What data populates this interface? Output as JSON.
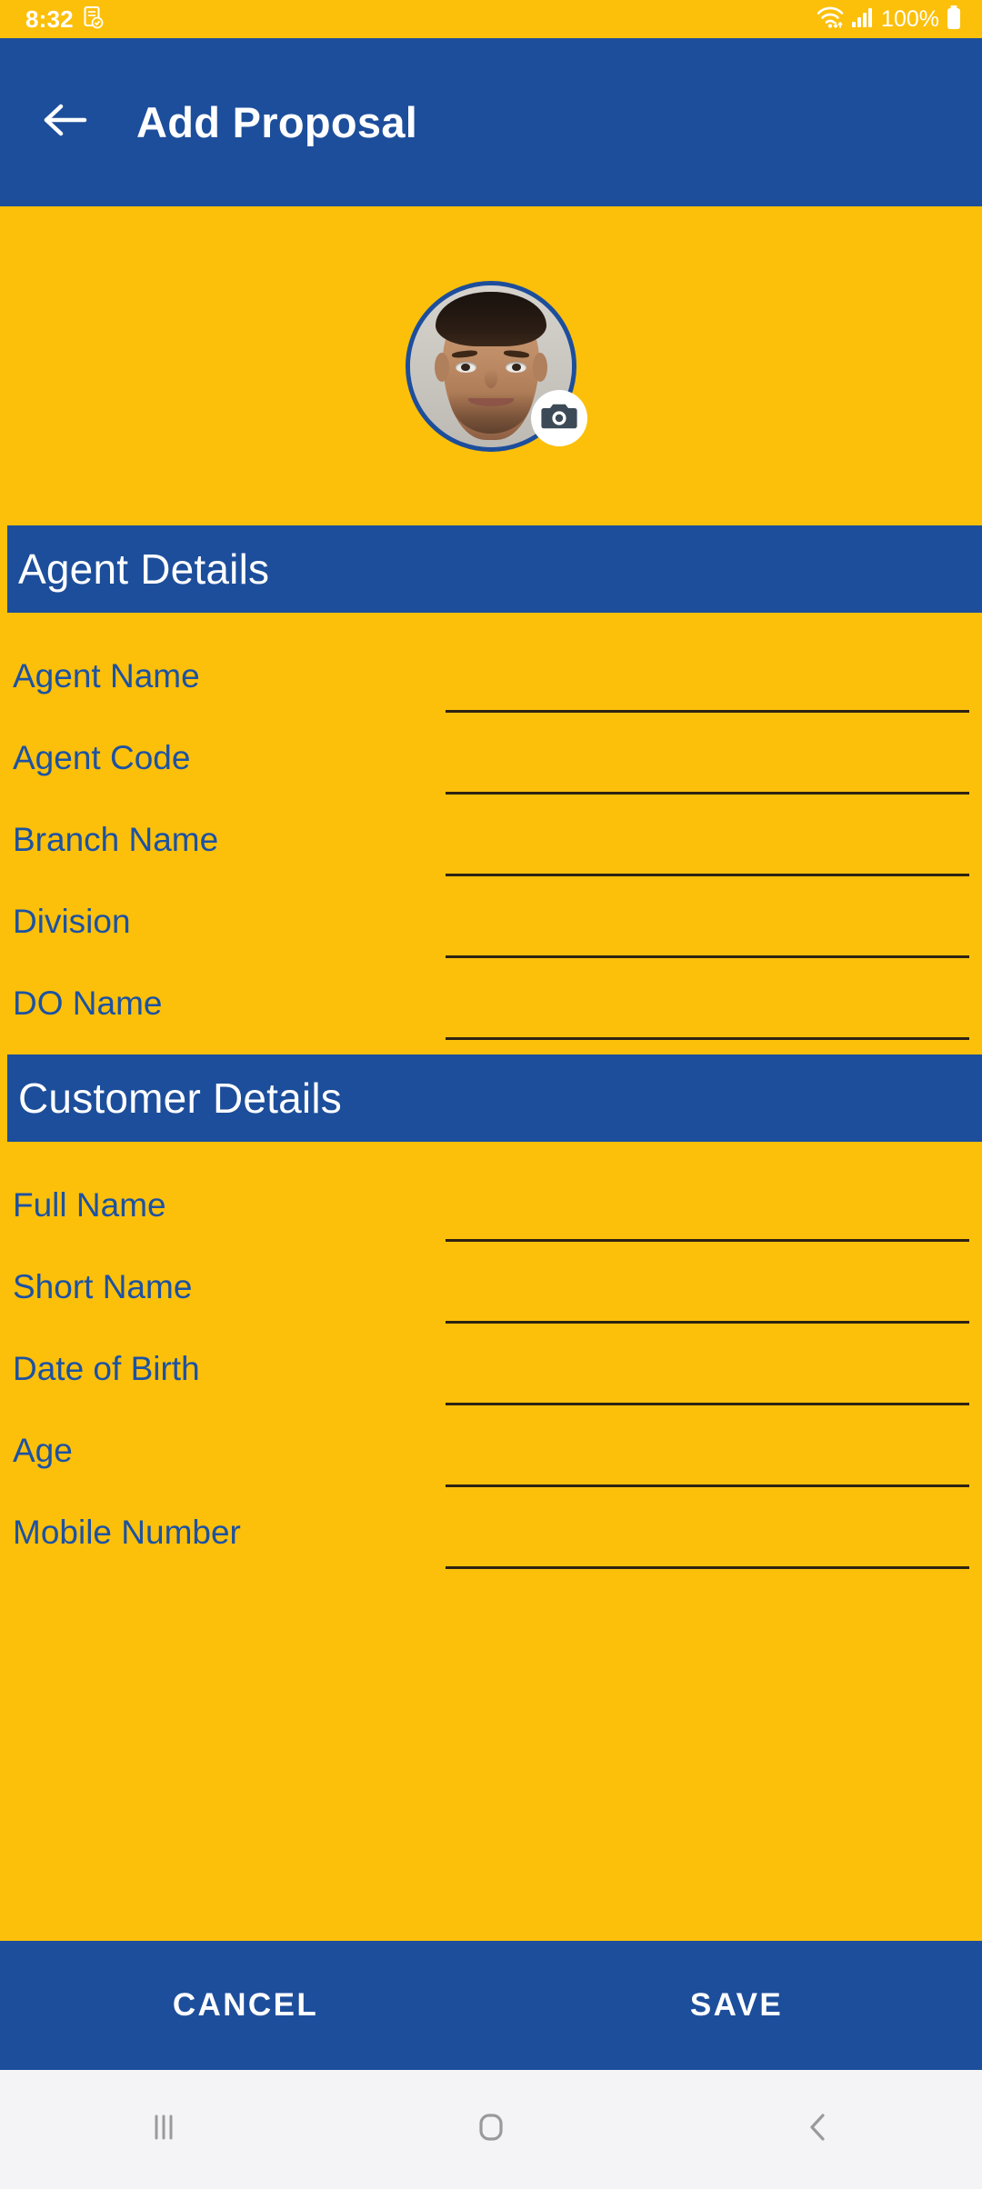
{
  "status_bar": {
    "time": "8:32",
    "battery_percent": "100%",
    "icons": [
      "note-icon",
      "wifi-icon",
      "cellular-signal-icon",
      "battery-icon"
    ]
  },
  "app_bar": {
    "back_icon": "arrow-left-icon",
    "title": "Add Proposal"
  },
  "profile": {
    "avatar_alt": "profile-photo",
    "camera_badge_icon": "camera-icon"
  },
  "sections": [
    {
      "title": "Agent Details",
      "fields": [
        {
          "label": "Agent Name",
          "value": "",
          "placeholder": ""
        },
        {
          "label": "Agent Code",
          "value": "",
          "placeholder": ""
        },
        {
          "label": "Branch Name",
          "value": "",
          "placeholder": ""
        },
        {
          "label": "Division",
          "value": "",
          "placeholder": ""
        },
        {
          "label": "DO Name",
          "value": "",
          "placeholder": ""
        }
      ]
    },
    {
      "title": "Customer Details",
      "fields": [
        {
          "label": "Full Name",
          "value": "",
          "placeholder": ""
        },
        {
          "label": "Short Name",
          "value": "",
          "placeholder": ""
        },
        {
          "label": "Date of Birth",
          "value": "",
          "placeholder": ""
        },
        {
          "label": "Age",
          "value": "",
          "placeholder": ""
        },
        {
          "label": "Mobile Number",
          "value": "",
          "placeholder": ""
        }
      ]
    }
  ],
  "bottom_bar": {
    "cancel_label": "CANCEL",
    "save_label": "SAVE"
  },
  "nav_bar": {
    "recents_icon": "recents-icon",
    "home_icon": "home-icon",
    "back_icon": "back-chevron-icon"
  },
  "colors": {
    "primary_blue": "#1D4E9B",
    "accent_yellow": "#FCC00B",
    "label_blue": "#1D52A2",
    "underline": "#2E2212",
    "nav_background": "#F4F4F6",
    "on_primary": "#FFFFFF"
  }
}
